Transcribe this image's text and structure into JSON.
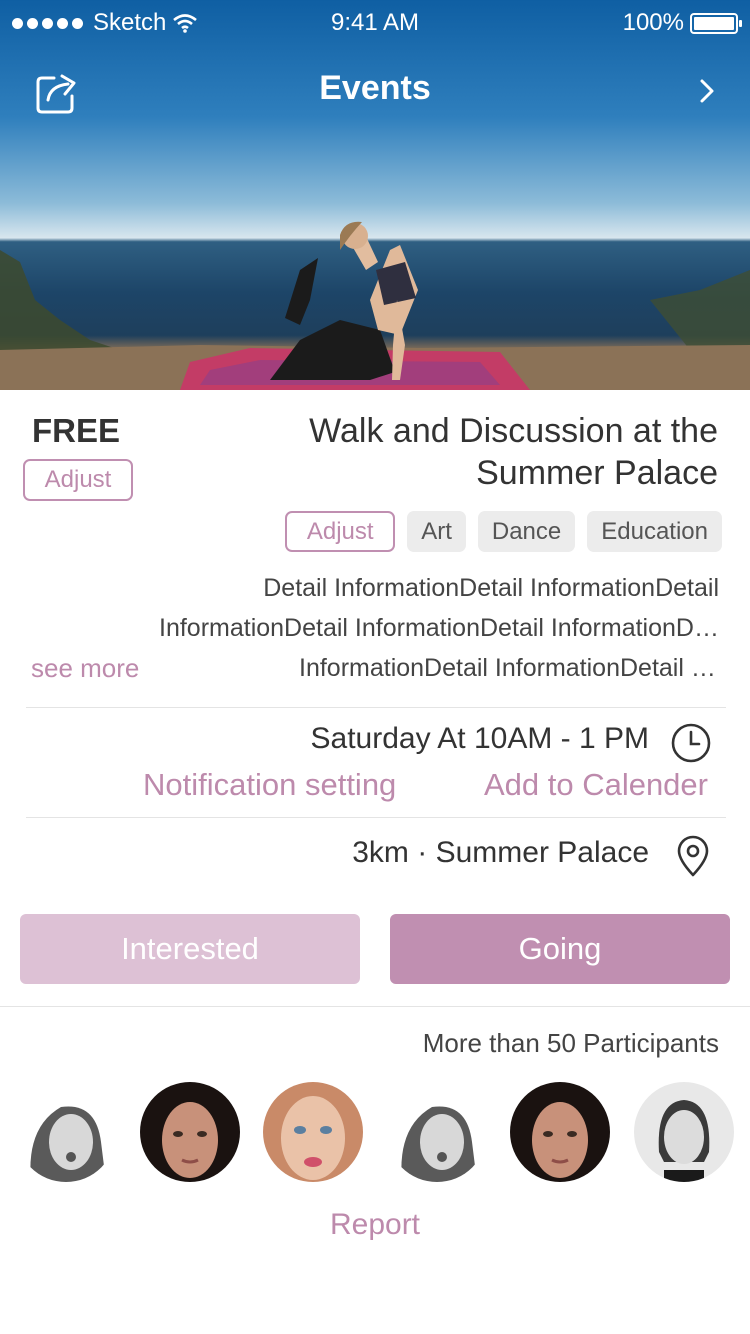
{
  "status_bar": {
    "carrier": "Sketch",
    "time": "9:41 AM",
    "battery": "100%"
  },
  "nav": {
    "title": "Events"
  },
  "event": {
    "price": "FREE",
    "price_adjust_label": "Adjust",
    "title": "Walk and Discussion at the Summer Palace",
    "tag_adjust_label": "Adjust",
    "tags": [
      "Art",
      "Dance",
      "Education"
    ],
    "detail_lines": [
      "Detail InformationDetail InformationDetail",
      "InformationDetail InformationDetail InformationDetail",
      "InformationDetail InformationDetail Inf..."
    ],
    "see_more": "see more",
    "time": "Saturday At 10AM - 1 PM",
    "notification_setting": "Notification setting",
    "add_to_calendar": "Add to Calender",
    "location": "3km · Summer Palace"
  },
  "actions": {
    "interested": "Interested",
    "going": "Going"
  },
  "participants": {
    "label": "More than 50 Participants"
  },
  "report": "Report",
  "colors": {
    "accent": "#bd8aac",
    "going_bg": "#c08fb1",
    "interested_bg": "#ddc1d5"
  }
}
